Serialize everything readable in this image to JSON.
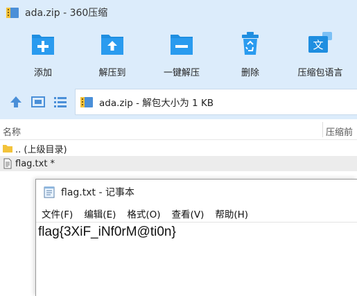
{
  "zip_window": {
    "title": "ada.zip - 360压缩",
    "toolbar": [
      {
        "label": "添加",
        "icon": "add-icon"
      },
      {
        "label": "解压到",
        "icon": "extract-to-icon"
      },
      {
        "label": "一键解压",
        "icon": "one-click-extract-icon"
      },
      {
        "label": "删除",
        "icon": "recycle-bin-icon"
      },
      {
        "label": "压缩包语言",
        "icon": "archive-language-icon"
      }
    ],
    "address": {
      "text": "ada.zip - 解包大小为 1 KB"
    },
    "columns": {
      "name": "名称",
      "compressed": "压缩前"
    },
    "files": [
      {
        "label": ".. (上级目录)",
        "icon": "folder-icon"
      },
      {
        "label": "flag.txt *",
        "icon": "text-file-icon"
      }
    ]
  },
  "notepad": {
    "title": "flag.txt - 记事本",
    "menus": [
      "文件(F)",
      "编辑(E)",
      "格式(O)",
      "查看(V)",
      "帮助(H)"
    ],
    "content": "flag{3XiF_iNf0rM@ti0n}"
  },
  "colors": {
    "toolbar_bg": "#dcecfb",
    "icon_blue": "#1f8ee0",
    "folder_yellow": "#f3c33b"
  }
}
